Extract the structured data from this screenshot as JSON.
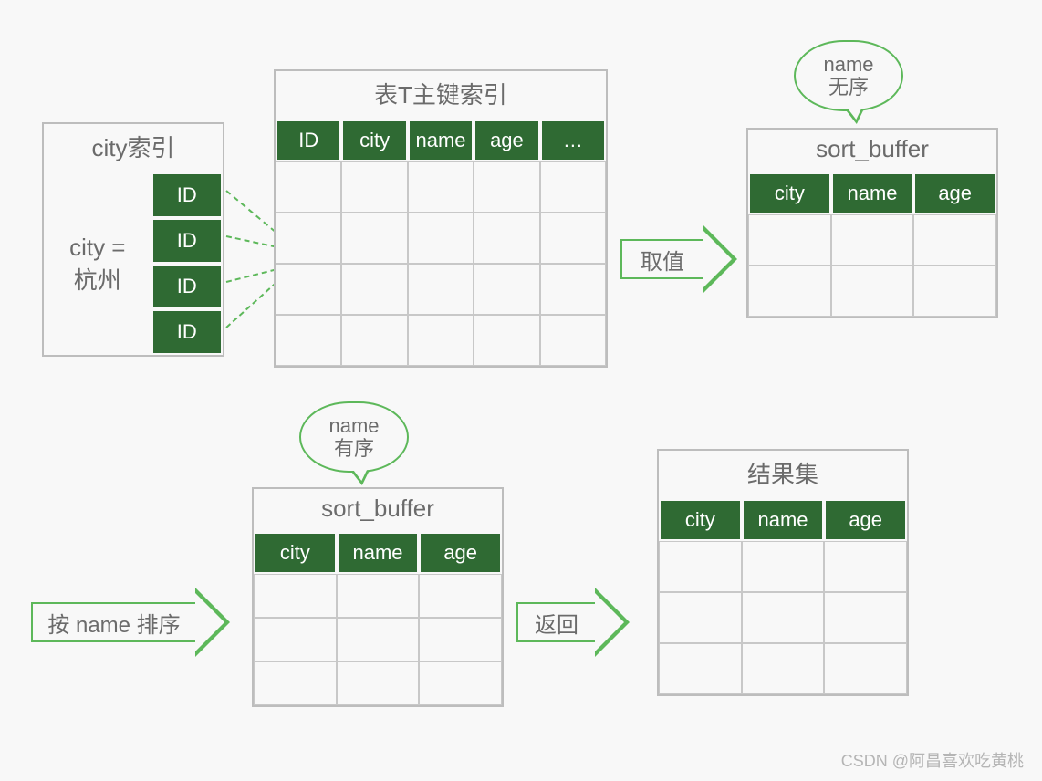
{
  "colors": {
    "green": "#2f6a33",
    "line": "#5db85a",
    "border": "#bdbdbd",
    "text": "#6b6b6b"
  },
  "cityIndex": {
    "title": "city索引",
    "condition_line1": "city =",
    "condition_line2": "杭州",
    "ids": [
      "ID",
      "ID",
      "ID",
      "ID"
    ]
  },
  "primaryIndex": {
    "title": "表T主键索引",
    "headers": [
      "ID",
      "city",
      "name",
      "age",
      "…"
    ],
    "rows": 4
  },
  "sortBuffer1": {
    "title": "sort_buffer",
    "headers": [
      "city",
      "name",
      "age"
    ],
    "rows": 2,
    "bubble_line1": "name",
    "bubble_line2": "无序"
  },
  "sortBuffer2": {
    "title": "sort_buffer",
    "headers": [
      "city",
      "name",
      "age"
    ],
    "rows": 3,
    "bubble_line1": "name",
    "bubble_line2": "有序"
  },
  "resultSet": {
    "title": "结果集",
    "headers": [
      "city",
      "name",
      "age"
    ],
    "rows": 3
  },
  "arrows": {
    "fetch": "取值",
    "sort": "按 name 排序",
    "return": "返回"
  },
  "watermark": "CSDN @阿昌喜欢吃黄桃"
}
